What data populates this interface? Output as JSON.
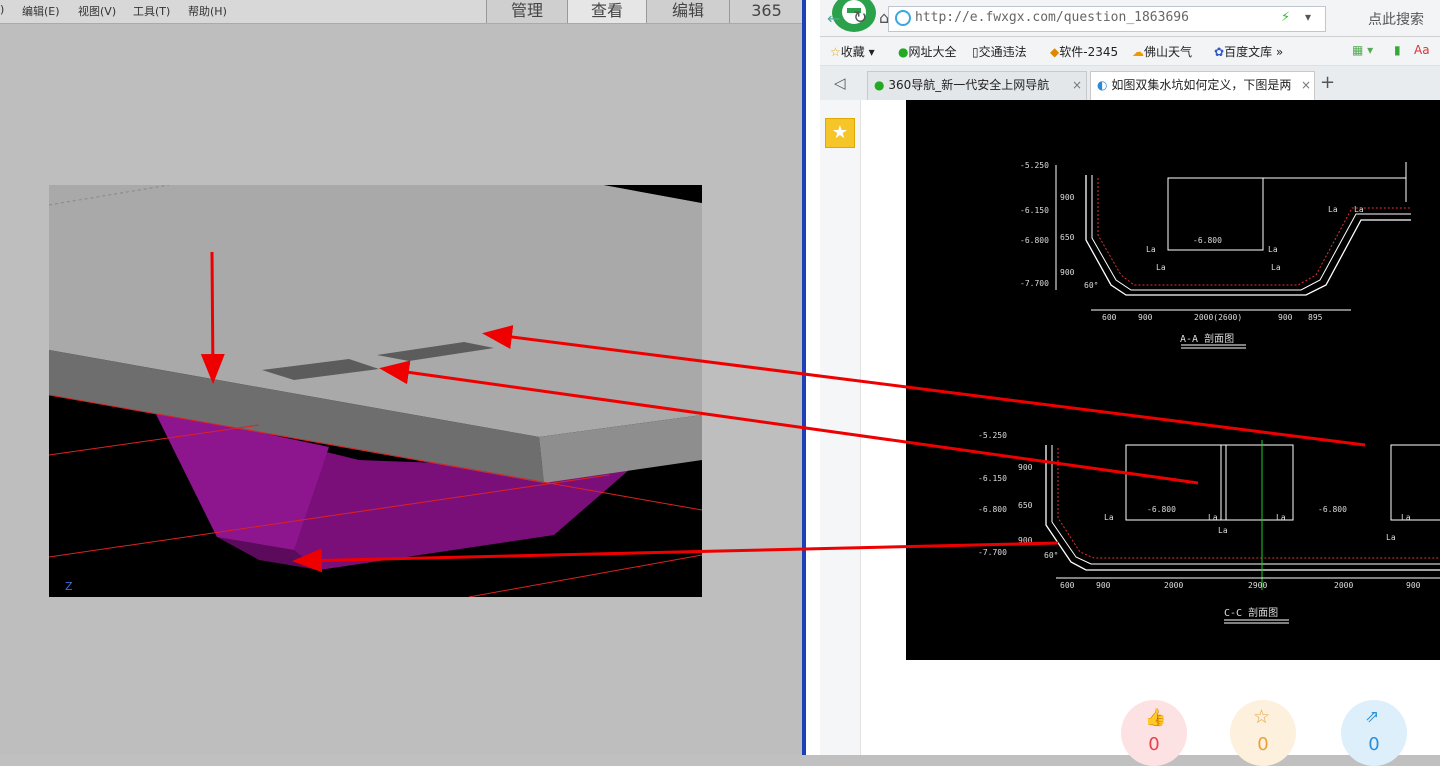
{
  "left_app": {
    "menu": [
      "编辑(E)",
      "视图(V)",
      "工具(T)",
      "帮助(H)"
    ],
    "mode_tabs": [
      "管理",
      "查看",
      "编辑",
      "365"
    ],
    "active_tab": "查看",
    "axis_label": "Z"
  },
  "browser": {
    "url": "http://e.fwxgx.com/question_1863696",
    "search_placeholder": "点此搜索",
    "bookmarks": [
      "收藏",
      "网址大全",
      "交通违法",
      "软件-2345",
      "佛山天气",
      "百度文库"
    ],
    "tabs": [
      {
        "label": "360导航_新一代安全上网导航",
        "active": false
      },
      {
        "label": "如图双集水坑如何定义，下图是两",
        "active": true
      }
    ],
    "actions": [
      {
        "icon": "thumbs-up-icon",
        "count": "0",
        "color": "#e8434e"
      },
      {
        "icon": "star-icon",
        "count": "0",
        "color": "#e9a23b"
      },
      {
        "icon": "share-icon",
        "count": "0",
        "color": "#2f8fd6"
      }
    ]
  },
  "cad": {
    "section_aa": {
      "title": "A-A 剖面图",
      "elevations": [
        "-5.250",
        "-6.150",
        "-6.800",
        "-7.700"
      ],
      "left_dims": [
        "900",
        "650",
        "900"
      ],
      "bottom_dims": [
        "600",
        "900",
        "2000(2600)",
        "900",
        "895"
      ],
      "inner_labels": [
        "-6.800",
        "La",
        "La",
        "La",
        "La",
        "La",
        "La"
      ],
      "angle": "60°"
    },
    "section_cc": {
      "title": "C-C 剖面图",
      "elevations": [
        "-5.250",
        "-6.150",
        "-6.800",
        "-7.700"
      ],
      "left_dims": [
        "900",
        "650",
        "900"
      ],
      "bottom_dims": [
        "600",
        "900",
        "2000",
        "2900",
        "2000",
        "900"
      ],
      "inner_labels": [
        "-6.800",
        "-6.800",
        "La",
        "La",
        "La",
        "La",
        "La",
        "La"
      ],
      "angle": "60°"
    }
  }
}
